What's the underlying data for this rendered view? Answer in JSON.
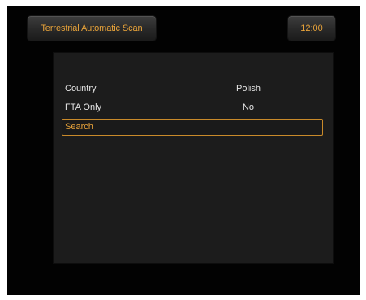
{
  "header": {
    "title": "Terrestrial Automatic Scan",
    "clock": "12:00"
  },
  "menu": {
    "items": [
      {
        "label": "Country",
        "value": "Polish"
      },
      {
        "label": "FTA Only",
        "value": "No"
      },
      {
        "label": "Search"
      }
    ],
    "selected_index": 2
  },
  "colors": {
    "accent": "#e8a33a",
    "panel": "#1c1c1c",
    "background": "#020202"
  }
}
